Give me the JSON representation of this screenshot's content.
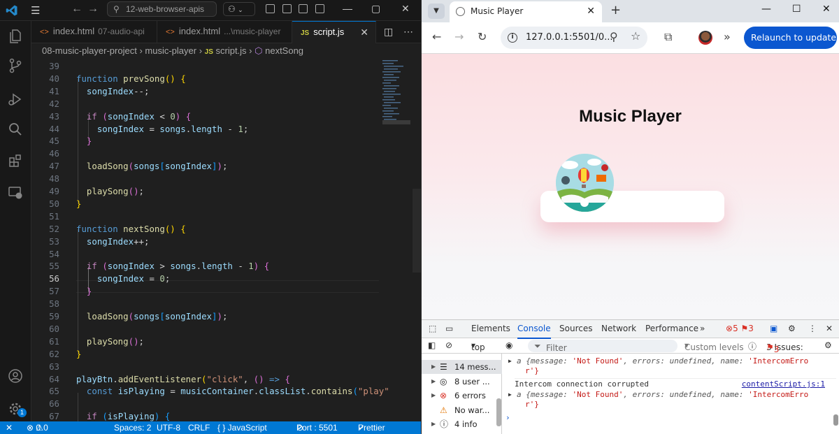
{
  "vscode": {
    "search_text": "12-web-browser-apis",
    "tabs": [
      {
        "label": "index.html",
        "desc": "07-audio-api"
      },
      {
        "label": "index.html",
        "desc": "...\\music-player"
      },
      {
        "label": "script.js",
        "desc": ""
      }
    ],
    "breadcrumb": [
      "08-music-player-project",
      "music-player",
      "script.js",
      "nextSong"
    ],
    "code_lines": [
      {
        "n": "39",
        "html": ""
      },
      {
        "n": "40",
        "html": "<span class='kw'>function</span> <span class='fn'>prevSong</span><span class='br1'>()</span> <span class='br1'>{</span>"
      },
      {
        "n": "41",
        "html": "  <span class='vr'>songIndex</span><span class='op'>--;</span>"
      },
      {
        "n": "42",
        "html": ""
      },
      {
        "n": "43",
        "html": "  <span class='pl'>if</span> <span class='br2'>(</span><span class='vr'>songIndex</span> <span class='op'>&lt;</span> <span class='nm'>0</span><span class='br2'>)</span> <span class='br2'>{</span>"
      },
      {
        "n": "44",
        "html": "    <span class='vr'>songIndex</span> <span class='op'>=</span> <span class='vr'>songs</span>.<span class='vr'>length</span> <span class='op'>-</span> <span class='nm'>1</span>;"
      },
      {
        "n": "45",
        "html": "  <span class='br2'>}</span>"
      },
      {
        "n": "46",
        "html": ""
      },
      {
        "n": "47",
        "html": "  <span class='fn'>loadSong</span><span class='br2'>(</span><span class='vr'>songs</span><span class='br3'>[</span><span class='vr'>songIndex</span><span class='br3'>]</span><span class='br2'>)</span>;"
      },
      {
        "n": "48",
        "html": ""
      },
      {
        "n": "49",
        "html": "  <span class='fn'>playSong</span><span class='br2'>()</span>;"
      },
      {
        "n": "50",
        "html": "<span class='br1'>}</span>"
      },
      {
        "n": "51",
        "html": ""
      },
      {
        "n": "52",
        "html": "<span class='kw'>function</span> <span class='fn'>nextSong</span><span class='br1'>()</span> <span class='br1'>{</span>"
      },
      {
        "n": "53",
        "html": "  <span class='vr'>songIndex</span><span class='op'>++;</span>"
      },
      {
        "n": "54",
        "html": ""
      },
      {
        "n": "55",
        "html": "  <span class='pl'>if</span> <span class='br2'>(</span><span class='vr'>songIndex</span> <span class='op'>&gt;</span> <span class='vr'>songs</span>.<span class='vr'>length</span> <span class='op'>-</span> <span class='nm'>1</span><span class='br2'>)</span> <span class='br2'>{</span>"
      },
      {
        "n": "56",
        "html": "    <span class='vr'>songIndex</span> <span class='op'>=</span> <span class='nm'>0</span>;"
      },
      {
        "n": "57",
        "html": "  <span class='br2'>}</span>"
      },
      {
        "n": "58",
        "html": ""
      },
      {
        "n": "59",
        "html": "  <span class='fn'>loadSong</span><span class='br2'>(</span><span class='vr'>songs</span><span class='br3'>[</span><span class='vr'>songIndex</span><span class='br3'>]</span><span class='br2'>)</span>;"
      },
      {
        "n": "60",
        "html": ""
      },
      {
        "n": "61",
        "html": "  <span class='fn'>playSong</span><span class='br2'>()</span>;"
      },
      {
        "n": "62",
        "html": "<span class='br1'>}</span>"
      },
      {
        "n": "63",
        "html": ""
      },
      {
        "n": "64",
        "html": "<span class='vr'>playBtn</span>.<span class='fn'>addEventListener</span><span class='br1'>(</span><span class='st'>\"click\"</span>, <span class='br2'>()</span> <span class='kw'>=&gt;</span> <span class='br2'>{</span>"
      },
      {
        "n": "65",
        "html": "  <span class='kw'>const</span> <span class='vr'>isPlaying</span> <span class='op'>=</span> <span class='vr'>musicContainer</span>.<span class='vr'>classList</span>.<span class='fn'>contains</span><span class='br3'>(</span><span class='st'>\"play\"</span>"
      },
      {
        "n": "66",
        "html": ""
      },
      {
        "n": "67",
        "html": "  <span class='pl'>if</span> <span class='br3'>(</span><span class='vr'>isPlaying</span><span class='br3'>)</span> <span class='br3'>{</span>"
      }
    ],
    "current_line": "56",
    "status": {
      "errors": "0",
      "warnings": "0",
      "spaces": "Spaces: 2",
      "encoding": "UTF-8",
      "eol": "CRLF",
      "language": "{ } JavaScript",
      "port": "Port : 5501",
      "prettier": "Prettier"
    },
    "account_badge": "1"
  },
  "chrome": {
    "tab_title": "Music Player",
    "url": "127.0.0.1:5501/0...",
    "relaunch_label": "Relaunch to update",
    "page_heading": "Music Player",
    "devtools": {
      "tabs": [
        "Elements",
        "Console",
        "Sources",
        "Network",
        "Performance"
      ],
      "active_tab": "Console",
      "error_count": "5",
      "issue_count": "3",
      "context": "top",
      "filter_placeholder": "Filter",
      "levels": "Custom levels",
      "issues_label": "3 Issues:",
      "issues_num": "3",
      "sidebar": [
        {
          "label": "14 mess...",
          "icon": "list-icon"
        },
        {
          "label": "8 user ...",
          "icon": "user-icon"
        },
        {
          "label": "6 errors",
          "icon": "error-icon"
        },
        {
          "label": "No war...",
          "icon": "warning-icon"
        },
        {
          "label": "4 info",
          "icon": "info-icon"
        }
      ],
      "console_message": "Intercom connection corrupted",
      "console_source": "contentScript.js:1",
      "obj_prefix": "a {message: ",
      "obj_msg": "'Not Found'",
      "obj_mid": ", errors: undefined, name: ",
      "obj_name": "'IntercomErro",
      "obj_tail": "r'}"
    }
  }
}
